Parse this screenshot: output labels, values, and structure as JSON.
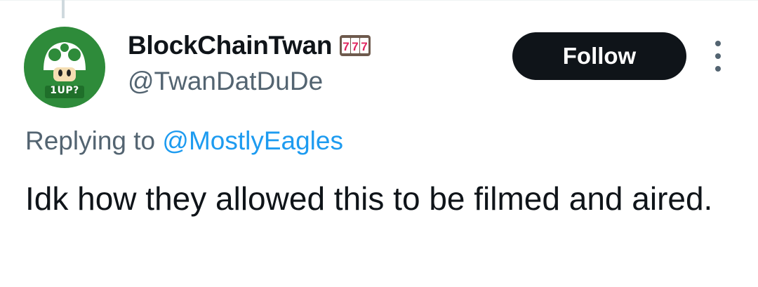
{
  "tweet": {
    "author": {
      "display_name": "BlockChainTwan",
      "handle": "@TwanDatDuDe",
      "name_badge_icon": "slot-machine-777-icon",
      "avatar": {
        "icon": "1up-mushroom-icon",
        "text": "1UP?",
        "bg_color": "#2e8b3a"
      }
    },
    "follow_label": "Follow",
    "replying_prefix": "Replying to",
    "replying_to": "@MostlyEagles",
    "text": "Idk how they allowed this to be filmed and aired."
  },
  "colors": {
    "text": "#0f1419",
    "secondary": "#536471",
    "link": "#1d9bf0",
    "button_bg": "#0f1419"
  }
}
